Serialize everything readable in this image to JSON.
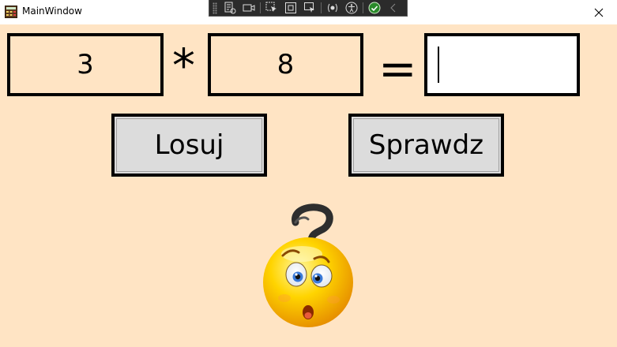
{
  "window": {
    "title": "MainWindow",
    "app_icon": "calculator-icon",
    "close_icon": "close-icon"
  },
  "debug_toolbar": {
    "icons": [
      "live-visual-tree-icon",
      "record-icon",
      "select-element-icon",
      "display-layout-adorners-icon",
      "track-focused-element-icon",
      "binding-failures-icon",
      "accessibility-icon",
      "hot-reload-ok-icon",
      "collapse-chevron-icon"
    ]
  },
  "equation": {
    "operand_a": "3",
    "operator": "*",
    "operand_b": "8",
    "equals": "=",
    "answer_value": ""
  },
  "buttons": {
    "losuj_label": "Losuj",
    "sprawdz_label": "Sprawdz"
  },
  "feedback": {
    "icon": "confused-face-icon"
  },
  "colors": {
    "background": "#ffe4c4",
    "button_background": "#dcdcdc",
    "border": "#000000"
  }
}
